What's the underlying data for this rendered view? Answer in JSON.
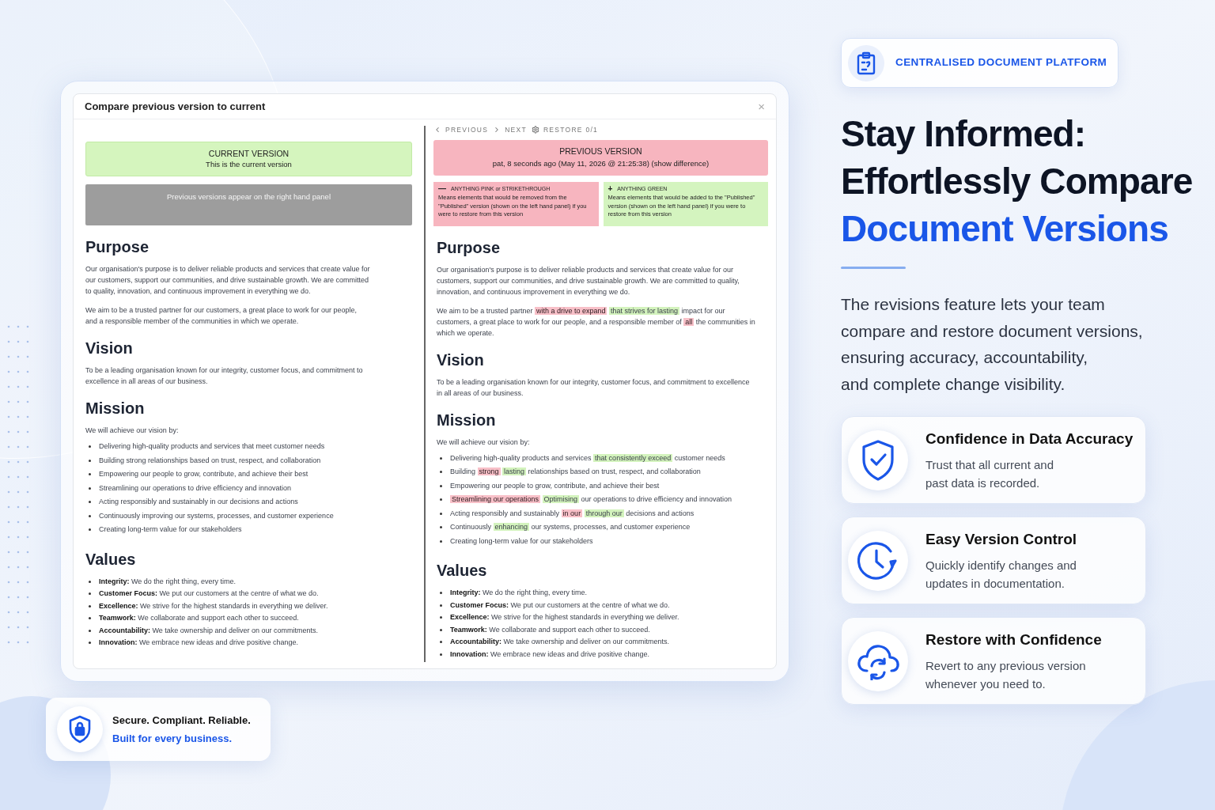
{
  "dialog": {
    "title": "Compare previous version to current",
    "close": "×",
    "left": {
      "current_banner": {
        "heading": "CURRENT VERSION",
        "text": "This is the current version"
      },
      "note": "Previous versions appear on the right hand panel",
      "sections": [
        {
          "kind": "text",
          "heading": "Purpose",
          "paragraphs": [
            [
              {
                "kind": "plain",
                "text": "Our organisation's purpose is to deliver reliable products and services that create value for our customers, support our communities, and drive sustainable growth. We are committed to quality, innovation, and continuous improvement in everything we do."
              }
            ],
            [
              {
                "kind": "plain",
                "text": "We aim to be a trusted partner for our customers, a great place to work for our people, and a responsible member of the communities in which we operate."
              }
            ]
          ]
        },
        {
          "kind": "text",
          "heading": "Vision",
          "paragraphs": [
            [
              {
                "kind": "plain",
                "text": "To be a leading organisation known for our integrity, customer focus, and commitment to excellence in all areas of our business."
              }
            ]
          ]
        },
        {
          "kind": "list",
          "heading": "Mission",
          "intro": "We will achieve our vision by:",
          "items": [
            [
              {
                "kind": "plain",
                "text": "Delivering high-quality products and services that meet customer needs"
              }
            ],
            [
              {
                "kind": "plain",
                "text": "Building strong relationships based on trust, respect, and collaboration"
              }
            ],
            [
              {
                "kind": "plain",
                "text": "Empowering our people to grow, contribute, and achieve their best"
              }
            ],
            [
              {
                "kind": "plain",
                "text": "Streamlining our operations to drive efficiency and innovation"
              }
            ],
            [
              {
                "kind": "plain",
                "text": "Acting responsibly and sustainably in our decisions and actions"
              }
            ],
            [
              {
                "kind": "plain",
                "text": "Continuously improving our systems, processes, and customer experience"
              }
            ],
            [
              {
                "kind": "plain",
                "text": "Creating long-term value for our stakeholders"
              }
            ]
          ]
        },
        {
          "kind": "values",
          "heading": "Values",
          "items": [
            "**Integrity:** We do the right thing, every time.",
            "**Customer Focus:** We put our customers at the centre of what we do.",
            "**Excellence:** We strive for the highest standards in everything we deliver.",
            "**Teamwork:** We collaborate and support each other to succeed.",
            "**Accountability:** We take ownership and deliver on our commitments.",
            "**Innovation:** We embrace new ideas and drive positive change."
          ]
        }
      ]
    },
    "right": {
      "toolbar": [
        {
          "kind": "previous",
          "label": "PREVIOUS"
        },
        {
          "kind": "next",
          "label": "NEXT"
        },
        {
          "kind": "restore",
          "label": "RESTORE 0/1"
        }
      ],
      "previous_banner": {
        "heading": "PREVIOUS VERSION",
        "text": "pat, 8 seconds ago (May 11, 2026 @ 21:25:38) (show difference)"
      },
      "legend": [
        {
          "kind": "removed",
          "sign": "—",
          "heading": "ANYTHING PINK or STRIKETHROUGH",
          "text": "Means elements that would be removed from the \"Published\" version (shown on the left hand panel) if you were to restore from this version"
        },
        {
          "kind": "added",
          "sign": "+",
          "heading": "ANYTHING GREEN",
          "text": "Means elements that would be added to the \"Published\" version (shown on the left hand panel) if you were to restore from this version"
        }
      ],
      "sections": [
        {
          "kind": "text",
          "heading": "Purpose",
          "paragraphs": [
            [
              {
                "kind": "plain",
                "text": "Our organisation's purpose is to deliver reliable products and services that create value for our customers, support our communities, and drive sustainable growth. We are committed to quality, innovation, and continuous improvement in everything we do."
              }
            ],
            [
              {
                "kind": "plain",
                "text": "We aim to be a trusted partner"
              },
              {
                "kind": "removed",
                "text": "with a drive to expand"
              },
              {
                "kind": "added",
                "text": "that strives for lasting"
              },
              {
                "kind": "plain",
                "text": "impact for our customers, a great place to work for our people, and a responsible member of"
              },
              {
                "kind": "removed",
                "text": "all"
              },
              {
                "kind": "plain",
                "text": "the communities in which we operate."
              }
            ]
          ]
        },
        {
          "kind": "text",
          "heading": "Vision",
          "paragraphs": [
            [
              {
                "kind": "plain",
                "text": "To be a leading organisation known for our integrity, customer focus, and commitment to excellence in all areas of our business."
              }
            ]
          ]
        },
        {
          "kind": "list",
          "heading": "Mission",
          "intro": "We will achieve our vision by:",
          "items": [
            [
              {
                "kind": "plain",
                "text": "Delivering high-quality products and services"
              },
              {
                "kind": "added",
                "text": "that consistently exceed"
              },
              {
                "kind": "plain",
                "text": "customer needs"
              }
            ],
            [
              {
                "kind": "plain",
                "text": "Building"
              },
              {
                "kind": "removed",
                "text": "strong"
              },
              {
                "kind": "added",
                "text": "lasting"
              },
              {
                "kind": "plain",
                "text": "relationships based on trust, respect, and collaboration"
              }
            ],
            [
              {
                "kind": "plain",
                "text": "Empowering our people to grow, contribute, and achieve their best"
              }
            ],
            [
              {
                "kind": "removed",
                "text": "Streamlining our operations"
              },
              {
                "kind": "added",
                "text": "Optimising"
              },
              {
                "kind": "plain",
                "text": "our operations to drive efficiency and innovation"
              }
            ],
            [
              {
                "kind": "plain",
                "text": "Acting responsibly and sustainably"
              },
              {
                "kind": "removed",
                "text": "in our"
              },
              {
                "kind": "added",
                "text": "through our"
              },
              {
                "kind": "plain",
                "text": "decisions and actions"
              }
            ],
            [
              {
                "kind": "plain",
                "text": "Continuously"
              },
              {
                "kind": "added",
                "text": "enhancing"
              },
              {
                "kind": "plain",
                "text": "our systems, processes, and customer experience"
              }
            ],
            [
              {
                "kind": "plain",
                "text": "Creating long-term value for our stakeholders"
              }
            ]
          ]
        },
        {
          "kind": "values",
          "heading": "Values",
          "items": [
            "**Integrity:** We do the right thing, every time.",
            "**Customer Focus:** We put our customers at the centre of what we do.",
            "**Excellence:** We strive for the highest standards in everything we deliver.",
            "**Teamwork:** We collaborate and support each other to succeed.",
            "**Accountability:** We take ownership and deliver on our commitments.",
            "**Innovation:** We embrace new ideas and drive positive change."
          ]
        }
      ]
    }
  },
  "trust_card": {
    "title": "Secure. Compliant. Reliable.",
    "subtitle": "Built for every business."
  },
  "badge": "CENTRALISED DOCUMENT PLATFORM",
  "headline": {
    "lines": [
      "Stay Informed:",
      "Effortlessly Compare"
    ],
    "accent": "Document Versions"
  },
  "intro_lines": [
    "The revisions feature lets your team",
    "compare and restore document versions,",
    "ensuring accuracy, accountability,",
    "and complete change visibility."
  ],
  "features": [
    {
      "kind": "shield",
      "title": "Confidence in Data Accuracy",
      "lines": [
        "Trust that all current and",
        "past data is recorded."
      ]
    },
    {
      "kind": "clock",
      "title": "Easy Version Control",
      "lines": [
        "Quickly identify changes and",
        "updates in documentation."
      ]
    },
    {
      "kind": "cloud",
      "title": "Restore with Confidence",
      "lines": [
        "Revert to any previous version",
        "whenever you need to."
      ]
    }
  ]
}
